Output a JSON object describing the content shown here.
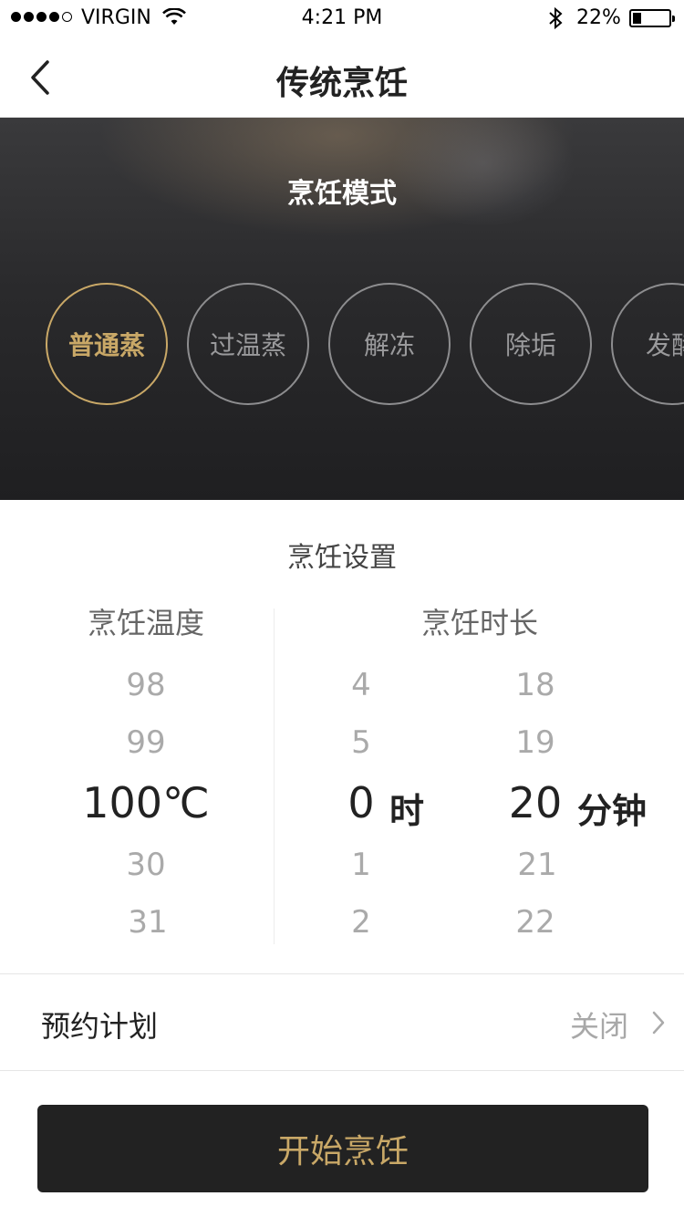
{
  "status_bar": {
    "carrier": "VIRGIN",
    "time": "4:21 PM",
    "battery_percent": "22%",
    "battery_level": 0.22,
    "signal_bars": 4
  },
  "nav": {
    "title": "传统烹饪",
    "back_icon": "chevron-left-icon"
  },
  "hero": {
    "section_title": "烹饪模式",
    "modes": [
      {
        "label": "普通蒸",
        "active": true
      },
      {
        "label": "过温蒸",
        "active": false
      },
      {
        "label": "解冻",
        "active": false
      },
      {
        "label": "除垢",
        "active": false
      },
      {
        "label": "发酵",
        "active": false
      }
    ]
  },
  "settings": {
    "title": "烹饪设置",
    "temperature": {
      "header": "烹饪温度",
      "values": [
        "98",
        "99",
        "100℃",
        "30",
        "31"
      ]
    },
    "duration": {
      "header": "烹饪时长",
      "hours": [
        "4",
        "5",
        "0",
        "1",
        "2"
      ],
      "hour_unit": "时",
      "minutes": [
        "18",
        "19",
        "20",
        "21",
        "22"
      ],
      "minute_unit": "分钟"
    }
  },
  "schedule": {
    "label": "预约计划",
    "value": "关闭"
  },
  "start_button": {
    "label": "开始烹饪"
  },
  "colors": {
    "accent_gold": "#c9a867",
    "dark_button": "#222222",
    "inactive_ring": "#8d8d8f"
  }
}
